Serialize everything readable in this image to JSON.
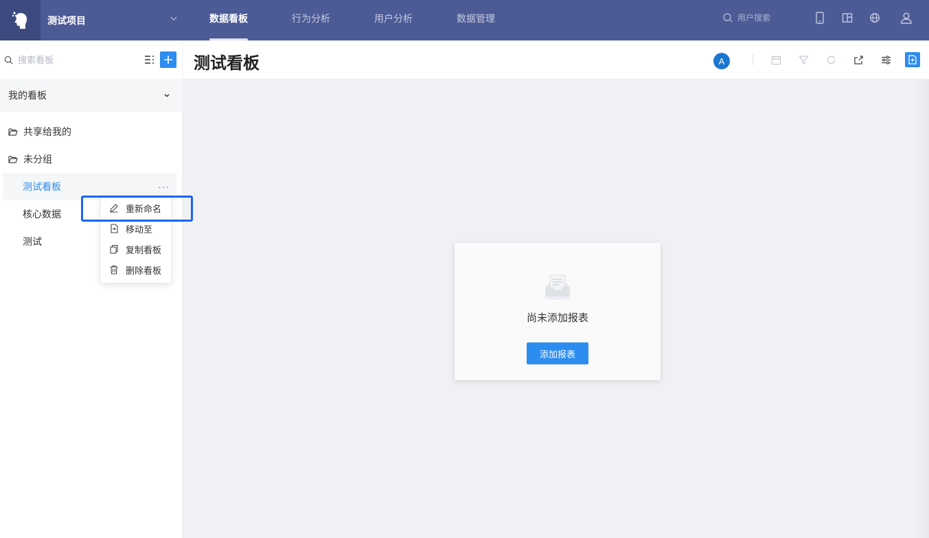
{
  "topbar": {
    "project_name": "测试项目",
    "tabs": [
      {
        "label": "数据看板",
        "active": true
      },
      {
        "label": "行为分析",
        "active": false
      },
      {
        "label": "用户分析",
        "active": false
      },
      {
        "label": "数据管理",
        "active": false
      }
    ],
    "search_placeholder": "用户搜索",
    "icons": [
      "mobile-icon",
      "layout-icon",
      "globe-icon",
      "user-icon"
    ]
  },
  "sidebar": {
    "search_placeholder": "搜索看板",
    "section_title": "我的看板",
    "folders": [
      {
        "label": "共享给我的"
      },
      {
        "label": "未分组"
      }
    ],
    "boards": [
      {
        "label": "测试看板",
        "active": true
      },
      {
        "label": "核心数据",
        "active": false
      },
      {
        "label": "测试",
        "active": false
      }
    ],
    "more_label": "···"
  },
  "context_menu": {
    "items": [
      {
        "label": "重新命名",
        "icon": "edit-icon"
      },
      {
        "label": "移动至",
        "icon": "move-icon"
      },
      {
        "label": "复制看板",
        "icon": "copy-icon"
      },
      {
        "label": "删除看板",
        "icon": "trash-icon"
      }
    ]
  },
  "main": {
    "title": "测试看板",
    "avatar_letter": "A",
    "header_icons": [
      "calendar-icon",
      "filter-icon",
      "refresh-icon",
      "share-icon",
      "settings-sliders-icon",
      "add-report-icon"
    ],
    "empty_state": {
      "message": "尚未添加报表",
      "button_label": "添加报表"
    }
  },
  "colors": {
    "topbar": "#4c5b96",
    "primary": "#2d8cf0",
    "highlight_border": "#1a63f0"
  }
}
